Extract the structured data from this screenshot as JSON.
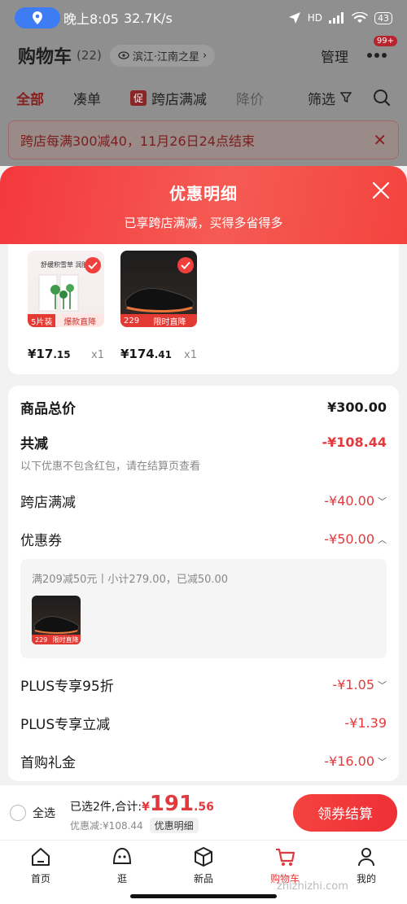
{
  "status": {
    "time": "晚上8:05",
    "speed": "32.7K/s",
    "net": "HD",
    "battery": "43"
  },
  "header": {
    "title": "购物车",
    "count": "(22)",
    "location": "滨江·江南之星",
    "manage": "管理",
    "badge": "99+"
  },
  "tabs": [
    {
      "label": "全部"
    },
    {
      "label": "凑单"
    },
    {
      "label": "跨店满减",
      "icon_text": "促"
    },
    {
      "label": "降价"
    },
    {
      "label": "筛选"
    }
  ],
  "notice": {
    "text": "跨店每满300减40，11月26日24点结束"
  },
  "sheet": {
    "title": "优惠明细",
    "subtitle": "已享跨店满减，买得多省得多"
  },
  "goods": [
    {
      "price_int": "¥17",
      "price_dec": ".15",
      "qty": "x1",
      "tag_a": "5片装",
      "tag_b": "爆款直降",
      "caption": "舒缓积雪草 润肤"
    },
    {
      "price_int": "¥174",
      "price_dec": ".41",
      "qty": "x1",
      "tag_a": "229",
      "tag_b": "限时直降"
    }
  ],
  "summary": {
    "total_label": "商品总价",
    "total_value": "¥300.00",
    "reduce_label": "共减",
    "reduce_value": "-¥108.44",
    "note": "以下优惠不包含红包，请在结算页查看",
    "lines": [
      {
        "label": "跨店满减",
        "value": "-¥40.00",
        "chev": "﹀"
      },
      {
        "label": "优惠券",
        "value": "-¥50.00",
        "chev": "︿"
      }
    ],
    "coupon_desc": "满209减50元丨小计279.00，已减50.00",
    "coupon_thumb_tag_a": "229",
    "coupon_thumb_tag_b": "限时直降",
    "lines2": [
      {
        "label": "PLUS专享95折",
        "value": "-¥1.05",
        "chev": "﹀"
      },
      {
        "label": "PLUS专享立减",
        "value": "-¥1.39",
        "chev": ""
      },
      {
        "label": "首购礼金",
        "value": "-¥16.00",
        "chev": "﹀"
      }
    ]
  },
  "checkout": {
    "select_all": "全选",
    "selected": "已选2件,合计:",
    "currency": "¥",
    "amount_int": "191",
    "amount_dec": ".56",
    "discount": "优惠减:¥108.44",
    "detail": "优惠明细",
    "button": "领券结算"
  },
  "tabbar": [
    {
      "label": "首页",
      "icon": "home-icon"
    },
    {
      "label": "逛",
      "icon": "face-icon"
    },
    {
      "label": "新品",
      "icon": "cube-icon"
    },
    {
      "label": "购物车",
      "icon": "cart-icon"
    },
    {
      "label": "我的",
      "icon": "user-icon"
    }
  ],
  "watermark": "zhizhizhi.com",
  "colors": {
    "accent": "#e4393c",
    "sheet_header": "#f4433f"
  }
}
